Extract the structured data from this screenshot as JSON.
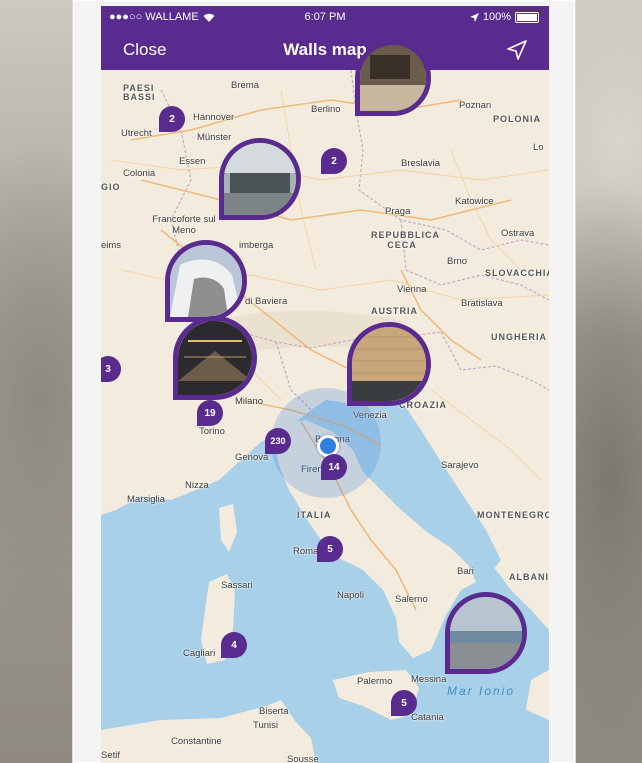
{
  "status": {
    "carrier": "●●●○○ WALLAME",
    "time": "6:07 PM",
    "battery": "100%"
  },
  "nav": {
    "close": "Close",
    "title": "Walls map"
  },
  "colors": {
    "accent": "#5a2b8f",
    "water": "#a8d0e8",
    "land": "#f3ecde"
  },
  "map": {
    "countries": [
      "PAESI BASSI",
      "POLONIA",
      "GIO",
      "REPUBBLICA CECA",
      "SLOVACCHIA",
      "AUSTRIA",
      "UNGHERIA",
      "CROAZIA",
      "ITALIA",
      "MONTENEGRO",
      "ALBANIA"
    ],
    "cities": [
      "Brema",
      "Hannover",
      "Berlino",
      "Poznan",
      "Utrecht",
      "Münster",
      "Essen",
      "Colonia",
      "Breslavia",
      "Francoforte sul Meno",
      "Praga",
      "Katowice",
      "Ostrava",
      "Brno",
      "imberga",
      "Vienna",
      "Bratislava",
      "di Baviera",
      "Milano",
      "Venezia",
      "Torino",
      "Genova",
      "Bologna",
      "Firenze",
      "Nizza",
      "Marsiglia",
      "Sarajevo",
      "Roma",
      "Bari",
      "Sassari",
      "Napoli",
      "Salerno",
      "Cagliari",
      "Palermo",
      "Messina",
      "Catania",
      "Biserta",
      "Tunisi",
      "Constantine",
      "Setif",
      "Sousse",
      "eims",
      "Lo"
    ],
    "sea": "Mar Ionio",
    "clusters": [
      "2",
      "2",
      "3",
      "19",
      "230",
      "14",
      "5",
      "4",
      "5"
    ]
  }
}
